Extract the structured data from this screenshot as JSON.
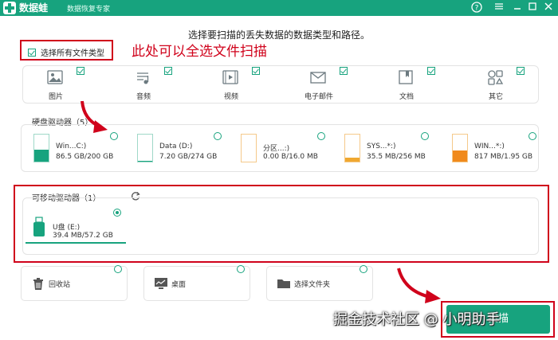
{
  "app": {
    "name": "数据蛙",
    "subtitle": "数据恢复专家"
  },
  "window_controls": [
    "help",
    "menu",
    "minimize",
    "maximize",
    "close"
  ],
  "instruction": "选择要扫描的丢失数据的数据类型和路径。",
  "select_all": {
    "label": "选择所有文件类型",
    "checked": true
  },
  "annotation": "此处可以全选文件扫描",
  "file_types": [
    {
      "label": "图片",
      "icon": "image-icon",
      "checked": true
    },
    {
      "label": "音频",
      "icon": "music-icon",
      "checked": true
    },
    {
      "label": "视频",
      "icon": "video-icon",
      "checked": true
    },
    {
      "label": "电子邮件",
      "icon": "mail-icon",
      "checked": true
    },
    {
      "label": "文档",
      "icon": "document-icon",
      "checked": true
    },
    {
      "label": "其它",
      "icon": "other-icon",
      "checked": true
    }
  ],
  "hard_drives": {
    "title": "硬盘驱动器（5）",
    "items": [
      {
        "name": "Win...C:)",
        "size": "86.5 GB/200 GB",
        "fill": 0.43,
        "color": "#17a37e"
      },
      {
        "name": "Data (D:)",
        "size": "7.20 GB/274 GB",
        "fill": 0.03,
        "color": "#17a37e"
      },
      {
        "name": "分区...:)",
        "size": "0.00  B/16.0 MB",
        "fill": 0.0,
        "color": "#f0a830"
      },
      {
        "name": "SYS...*:)",
        "size": "35.5 MB/256 MB",
        "fill": 0.14,
        "color": "#f0a830"
      },
      {
        "name": "WIN...*:)",
        "size": "817 MB/1.95 GB",
        "fill": 0.42,
        "color": "#f08a1c"
      }
    ]
  },
  "removable": {
    "title": "可移动驱动器（1）",
    "items": [
      {
        "name": "U盘 (E:)",
        "size": "39.4 MB/57.2 GB",
        "selected": true
      }
    ]
  },
  "locations": [
    {
      "label": "回收站",
      "icon": "trash-icon"
    },
    {
      "label": "桌面",
      "icon": "desktop-icon"
    },
    {
      "label": "选择文件夹",
      "icon": "folder-icon"
    }
  ],
  "scan_button": "扫描",
  "watermark": "掘金技术社区 @ 小明助手"
}
